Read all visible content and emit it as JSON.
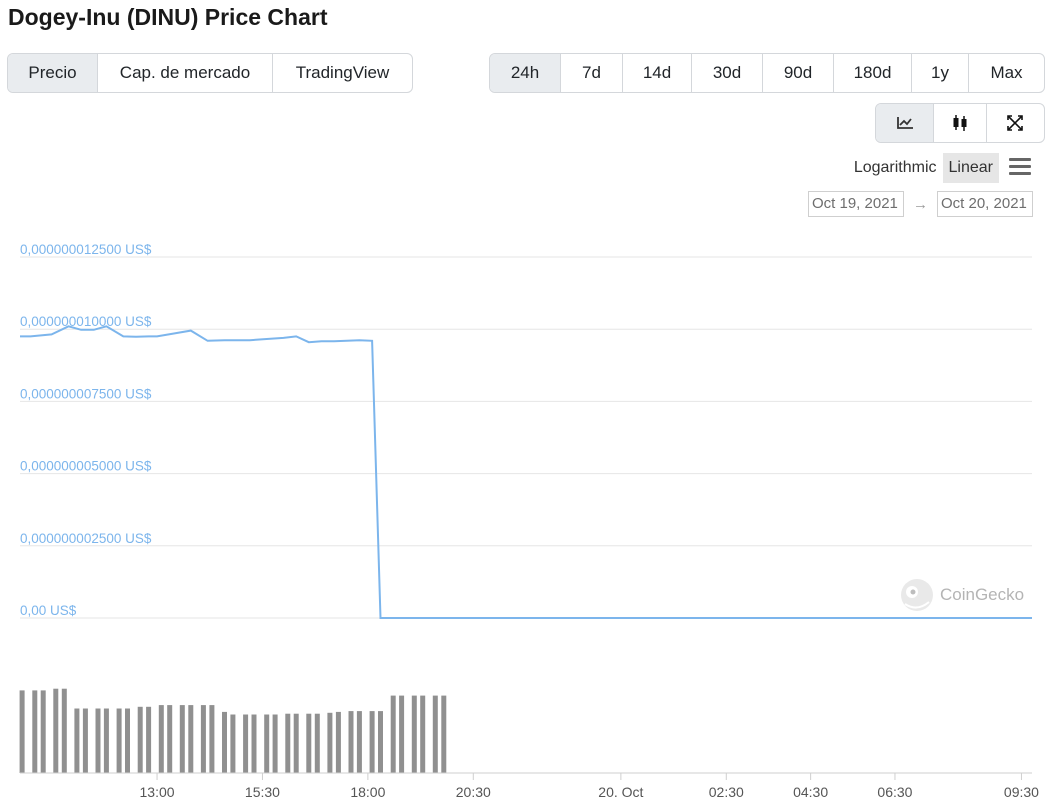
{
  "page": {
    "title": "Dogey-Inu (DINU) Price Chart"
  },
  "data_tabs": [
    {
      "label": "Precio",
      "active": true
    },
    {
      "label": "Cap. de mercado",
      "active": false
    },
    {
      "label": "TradingView",
      "active": false
    }
  ],
  "range_tabs": [
    {
      "label": "24h",
      "active": true
    },
    {
      "label": "7d",
      "active": false
    },
    {
      "label": "14d",
      "active": false
    },
    {
      "label": "30d",
      "active": false
    },
    {
      "label": "90d",
      "active": false
    },
    {
      "label": "180d",
      "active": false
    },
    {
      "label": "1y",
      "active": false
    },
    {
      "label": "Max",
      "active": false
    }
  ],
  "view_tabs": [
    {
      "icon": "line-chart-icon",
      "active": true
    },
    {
      "icon": "candlestick-icon",
      "active": false
    },
    {
      "icon": "fullscreen-icon",
      "active": false
    }
  ],
  "scale": {
    "logarithmic_label": "Logarithmic",
    "linear_label": "Linear",
    "selected": "Linear",
    "menu_icon": "hamburger-menu-icon"
  },
  "date_range": {
    "from": "Oct 19, 2021",
    "to": "Oct 20, 2021",
    "arrow": "→"
  },
  "watermark": {
    "text": "CoinGecko",
    "icon": "coingecko-logo-icon"
  },
  "colors": {
    "line": "#7cb5ec",
    "volume": "#909090",
    "grid": "#e6e6e6",
    "tab_active": "#e9ecef"
  },
  "chart_data": {
    "type": "line",
    "title": "Dogey-Inu (DINU) Price Chart",
    "xlabel": "",
    "ylabel": "",
    "y_tick_labels": [
      "0,000000012500 US$",
      "0,000000010000 US$",
      "0,000000007500 US$",
      "0,000000005000 US$",
      "0,000000002500 US$",
      "0,00 US$"
    ],
    "y_ticks": [
      1.25e-08,
      1e-08,
      7.5e-09,
      5e-09,
      2.5e-09,
      0
    ],
    "ylim": [
      0,
      1.25e-08
    ],
    "x_tick_labels": [
      "13:00",
      "15:30",
      "18:00",
      "20:30",
      "20. Oct",
      "02:30",
      "04:30",
      "06:30",
      "09:30"
    ],
    "x_ticks_hours": [
      13.0,
      15.5,
      18.0,
      20.5,
      24.0,
      26.5,
      28.5,
      30.5,
      33.5
    ],
    "xlim_hours": [
      9.75,
      33.75
    ],
    "grid": true,
    "series": [
      {
        "hours": [
          9.75,
          10.0,
          10.5,
          10.9,
          11.2,
          11.5,
          11.8,
          12.2,
          12.5,
          12.8,
          13.0,
          13.4,
          13.8,
          14.2,
          14.6,
          14.9,
          15.2,
          15.6,
          16.0,
          16.3,
          16.6,
          16.9,
          17.2,
          17.5,
          17.8,
          18.1,
          18.3,
          33.75
        ],
        "values": [
          9.75e-09,
          9.75e-09,
          9.82e-09,
          1.01e-08,
          9.98e-09,
          9.98e-09,
          1.01e-08,
          9.75e-09,
          9.74e-09,
          9.75e-09,
          9.75e-09,
          9.85e-09,
          9.95e-09,
          9.6e-09,
          9.62e-09,
          9.62e-09,
          9.62e-09,
          9.66e-09,
          9.7e-09,
          9.75e-09,
          9.55e-09,
          9.58e-09,
          9.58e-09,
          9.6e-09,
          9.62e-09,
          9.6e-09,
          0,
          0
        ]
      }
    ],
    "volume": {
      "hours": [
        9.8,
        10.1,
        10.3,
        10.6,
        10.8,
        11.1,
        11.3,
        11.6,
        11.8,
        12.1,
        12.3,
        12.6,
        12.8,
        13.1,
        13.3,
        13.6,
        13.8,
        14.1,
        14.3,
        14.6,
        14.8,
        15.1,
        15.3,
        15.6,
        15.8,
        16.1,
        16.3,
        16.6,
        16.8,
        17.1,
        17.3,
        17.6,
        17.8,
        18.1,
        18.3,
        18.6,
        18.8,
        19.1,
        19.3,
        19.6,
        19.8
      ],
      "values": [
        0.96,
        0.96,
        0.96,
        0.98,
        0.98,
        0.75,
        0.75,
        0.75,
        0.75,
        0.75,
        0.75,
        0.77,
        0.77,
        0.79,
        0.79,
        0.79,
        0.79,
        0.79,
        0.79,
        0.71,
        0.68,
        0.68,
        0.68,
        0.68,
        0.68,
        0.69,
        0.69,
        0.69,
        0.69,
        0.7,
        0.71,
        0.72,
        0.72,
        0.72,
        0.72,
        0.9,
        0.9,
        0.9,
        0.9,
        0.9,
        0.9
      ]
    }
  }
}
